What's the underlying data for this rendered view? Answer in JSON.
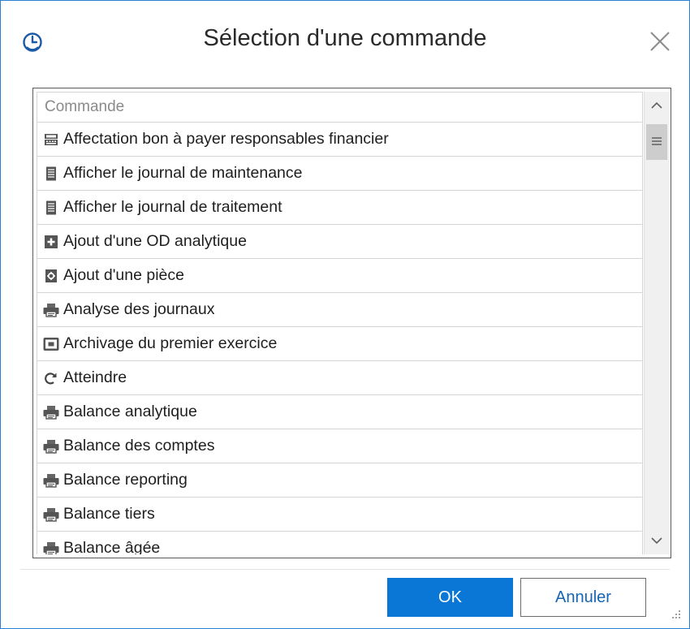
{
  "dialog": {
    "title": "Sélection d'une commande",
    "app_icon": "clock-circle-icon",
    "close_icon": "close-icon"
  },
  "list": {
    "column_header": "Commande",
    "rows": [
      {
        "label": "Affectation bon à payer responsables financier",
        "icon": "cash-register-icon"
      },
      {
        "label": "Afficher le journal de maintenance",
        "icon": "document-list-icon"
      },
      {
        "label": "Afficher le journal de traitement",
        "icon": "document-list-icon"
      },
      {
        "label": "Ajout d'une OD analytique",
        "icon": "add-document-icon"
      },
      {
        "label": "Ajout d'une pièce",
        "icon": "gear-document-icon"
      },
      {
        "label": "Analyse des journaux",
        "icon": "printer-icon"
      },
      {
        "label": "Archivage du premier exercice",
        "icon": "archive-icon"
      },
      {
        "label": "Atteindre",
        "icon": "redo-arrow-icon"
      },
      {
        "label": "Balance analytique",
        "icon": "printer-icon"
      },
      {
        "label": "Balance des comptes",
        "icon": "printer-icon"
      },
      {
        "label": "Balance reporting",
        "icon": "printer-icon"
      },
      {
        "label": "Balance tiers",
        "icon": "printer-icon"
      },
      {
        "label": "Balance âgée",
        "icon": "printer-icon"
      }
    ]
  },
  "scrollbar": {
    "up_icon": "chevron-up-icon",
    "down_icon": "chevron-down-icon",
    "thumb_icon": "grip-lines-icon"
  },
  "buttons": {
    "ok_label": "OK",
    "cancel_label": "Annuler"
  },
  "colors": {
    "accent": "#0a77d6",
    "dialog_border": "#2b7fd4",
    "cancel_text": "#1664b4"
  }
}
